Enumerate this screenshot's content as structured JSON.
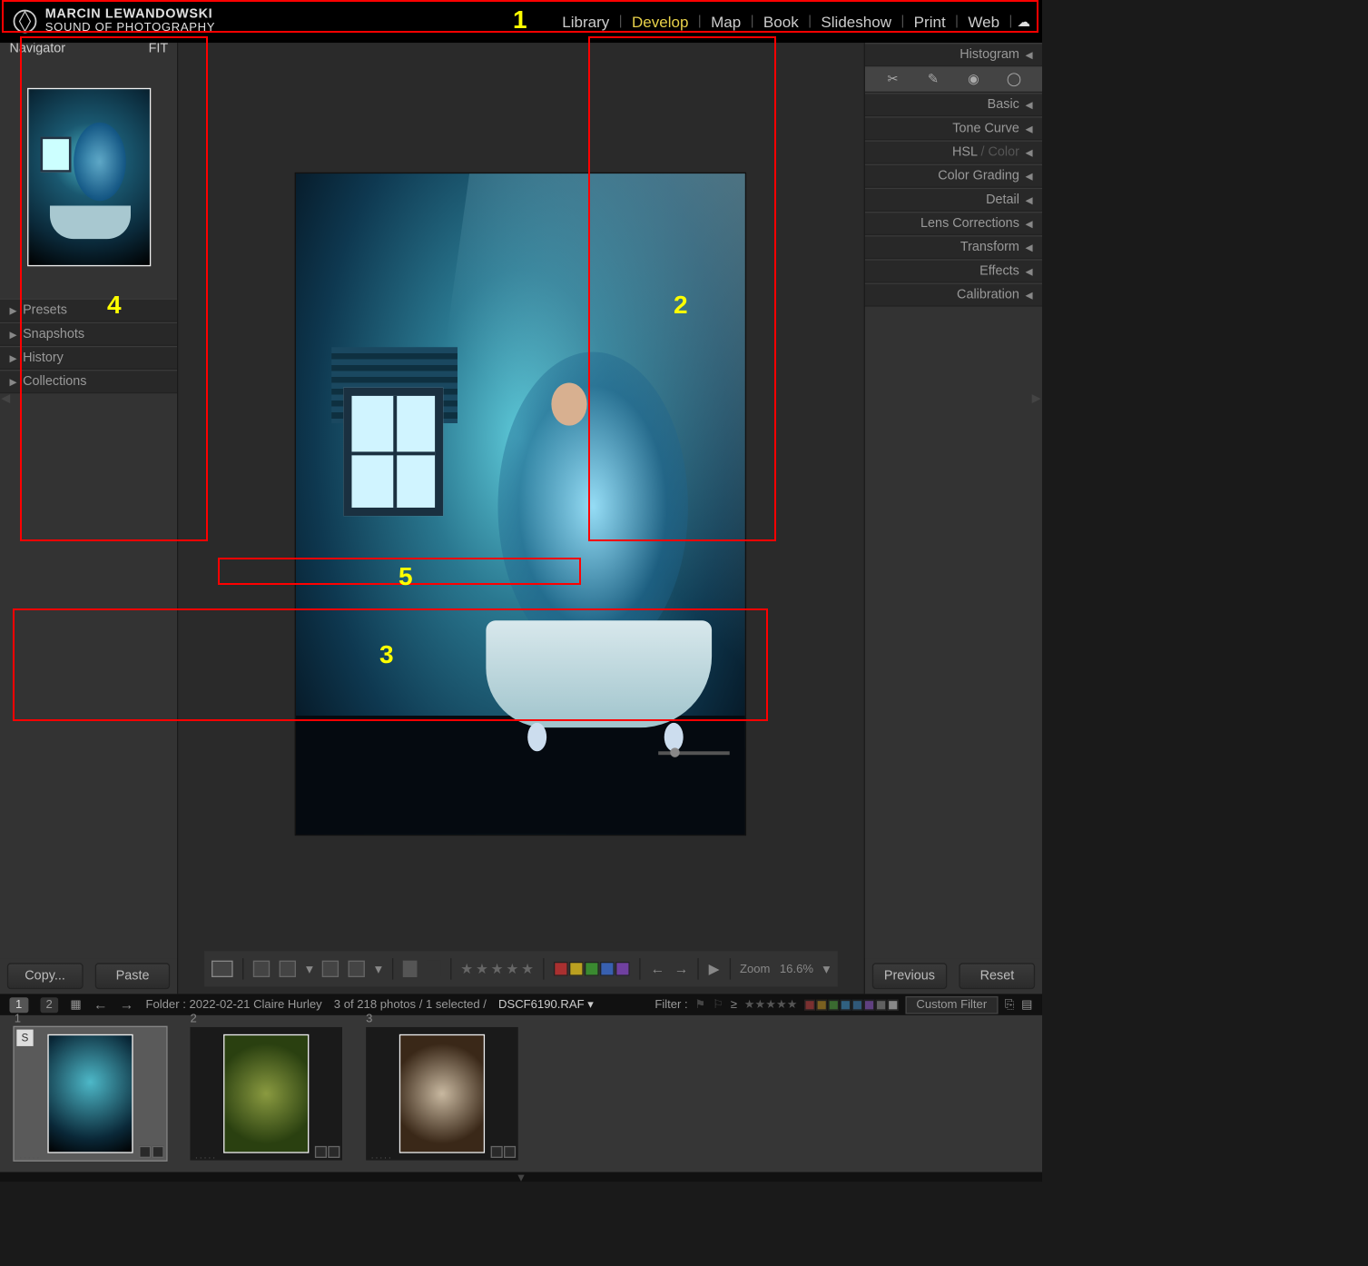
{
  "brand": {
    "line1": "MARCIN LEWANDOWSKI",
    "line2": "SOUND OF PHOTOGRAPHY"
  },
  "modules": [
    "Library",
    "Develop",
    "Map",
    "Book",
    "Slideshow",
    "Print",
    "Web"
  ],
  "active_module": "Develop",
  "left_panels": {
    "navigator": "Navigator",
    "nav_zoom": "FIT",
    "items": [
      "Presets",
      "Snapshots",
      "History",
      "Collections"
    ]
  },
  "left_buttons": {
    "copy": "Copy...",
    "paste": "Paste"
  },
  "right_panels": {
    "histogram": "Histogram",
    "items": [
      "Basic",
      "Tone Curve",
      "HSL / Color",
      "Color Grading",
      "Detail",
      "Lens Corrections",
      "Transform",
      "Effects",
      "Calibration"
    ]
  },
  "right_buttons": {
    "previous": "Previous",
    "reset": "Reset"
  },
  "toolbar": {
    "zoom_label": "Zoom",
    "zoom_value": "16.6%",
    "colors": [
      "#aa3030",
      "#bba020",
      "#3a8a30",
      "#3860b0",
      "#7040a0"
    ]
  },
  "status": {
    "grid1": "1",
    "grid2": "2",
    "folder": "Folder : 2022-02-21 Claire Hurley",
    "count": "3 of 218 photos / 1 selected /",
    "filename": "DSCF6190.RAF ▾",
    "filter_label": "Filter :",
    "custom_filter": "Custom Filter",
    "filter_colors": [
      "#7a3030",
      "#7a6020",
      "#3a6a30",
      "#306080",
      "#305878",
      "#604080",
      "#606060",
      "#888"
    ]
  },
  "filmstrip": [
    {
      "num": "1",
      "sel": true,
      "flag": "S"
    },
    {
      "num": "2",
      "sel": false
    },
    {
      "num": "3",
      "sel": false
    }
  ],
  "annotations": {
    "a1": "1",
    "a2": "2",
    "a3": "3",
    "a4": "4",
    "a5": "5"
  }
}
